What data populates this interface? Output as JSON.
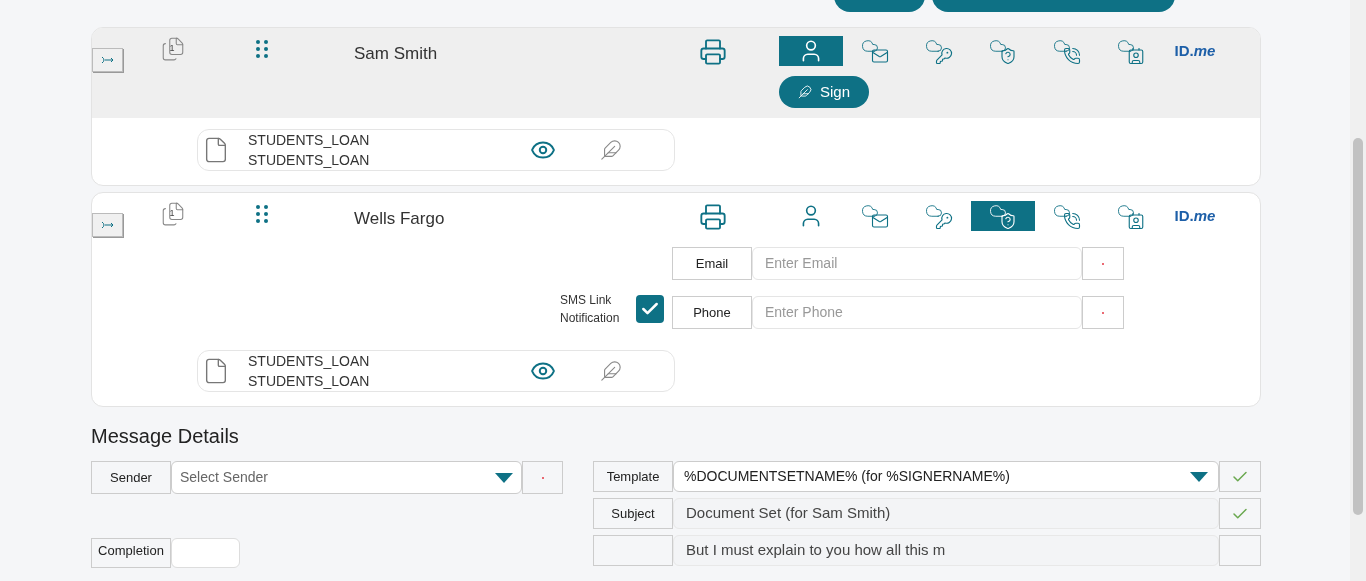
{
  "toolbar": {
    "buttons": [
      {
        "kind": "design"
      },
      {
        "kind": "attach"
      }
    ]
  },
  "recipients": [
    {
      "name": "Sam Smith",
      "page_count": "1",
      "active": true,
      "methods": [
        {
          "kind": "person",
          "selected": true
        },
        {
          "kind": "mail",
          "selected": false
        },
        {
          "kind": "key",
          "selected": false
        },
        {
          "kind": "shield",
          "selected": false
        },
        {
          "kind": "phone",
          "selected": false
        },
        {
          "kind": "contact",
          "selected": false
        },
        {
          "kind": "idme",
          "label": "ID.*me*",
          "selected": false
        }
      ],
      "sign_button": "Sign",
      "documents": [
        {
          "name": "STUDENTS_LOAN",
          "title": "STUDENTS_LOAN"
        }
      ]
    },
    {
      "name": "Wells Fargo",
      "page_count": "1",
      "active": false,
      "methods": [
        {
          "kind": "person",
          "selected": false
        },
        {
          "kind": "mail",
          "selected": false
        },
        {
          "kind": "key",
          "selected": false
        },
        {
          "kind": "shield",
          "selected": true
        },
        {
          "kind": "phone",
          "selected": false
        },
        {
          "kind": "contact",
          "selected": false
        },
        {
          "kind": "idme",
          "label": "ID.*me*",
          "selected": false
        }
      ],
      "contact_fields": [
        {
          "label": "Email",
          "placeholder": "Enter Email",
          "required": true
        },
        {
          "label": "Phone",
          "placeholder": "Enter Phone",
          "required": true
        }
      ],
      "sms_notification": {
        "label": "SMS Link Notification",
        "checked": true
      },
      "documents": [
        {
          "name": "STUDENTS_LOAN",
          "title": "STUDENTS_LOAN"
        }
      ]
    }
  ],
  "message_details": {
    "title": "Message Details",
    "sender": {
      "label": "Sender",
      "placeholder": "Select Sender",
      "required": true
    },
    "completion": {
      "label": "Completion"
    },
    "fields": [
      {
        "kind": "select",
        "label": "Template",
        "value": "%DOCUMENTSETNAME% (for %SIGNERNAME%)",
        "valid": true
      },
      {
        "kind": "text",
        "label": "Subject",
        "value": "Document Set (for Sam Smith)",
        "valid": true
      },
      {
        "kind": "text",
        "value": "But I must explain to you how all this m",
        "valid": false
      }
    ]
  }
}
